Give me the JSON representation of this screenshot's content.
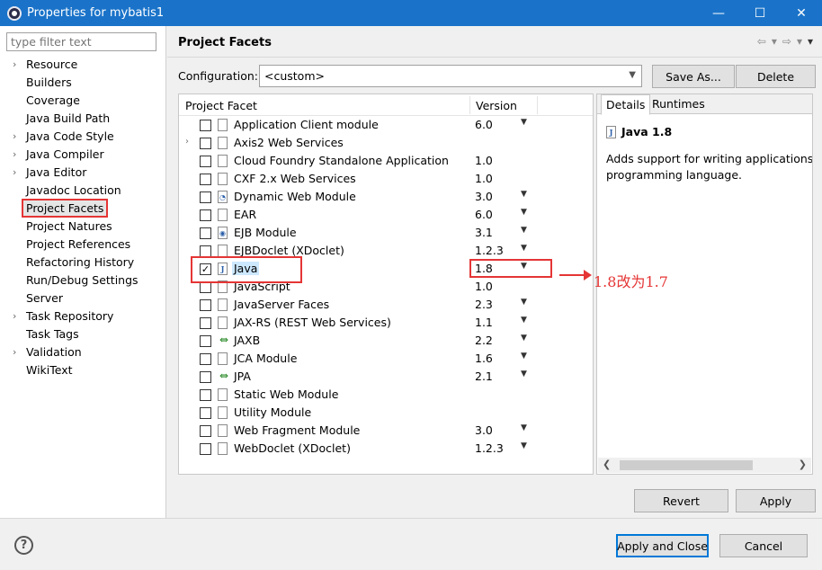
{
  "window": {
    "title": "Properties for mybatis1",
    "minimize": "—",
    "maximize": "☐",
    "close": "✕"
  },
  "filter": {
    "placeholder": "type filter text"
  },
  "nav": {
    "items": [
      {
        "label": "Resource",
        "expandable": true
      },
      {
        "label": "Builders",
        "expandable": false
      },
      {
        "label": "Coverage",
        "expandable": false
      },
      {
        "label": "Java Build Path",
        "expandable": false
      },
      {
        "label": "Java Code Style",
        "expandable": true
      },
      {
        "label": "Java Compiler",
        "expandable": true
      },
      {
        "label": "Java Editor",
        "expandable": true
      },
      {
        "label": "Javadoc Location",
        "expandable": false
      },
      {
        "label": "Project Facets",
        "expandable": false,
        "selected": true
      },
      {
        "label": "Project Natures",
        "expandable": false
      },
      {
        "label": "Project References",
        "expandable": false
      },
      {
        "label": "Refactoring History",
        "expandable": false
      },
      {
        "label": "Run/Debug Settings",
        "expandable": false
      },
      {
        "label": "Server",
        "expandable": false
      },
      {
        "label": "Task Repository",
        "expandable": true
      },
      {
        "label": "Task Tags",
        "expandable": false
      },
      {
        "label": "Validation",
        "expandable": true
      },
      {
        "label": "WikiText",
        "expandable": false
      }
    ]
  },
  "page": {
    "title": "Project Facets",
    "config_label": "Configuration:",
    "config_value": "<custom>",
    "save_as": "Save As...",
    "delete": "Delete"
  },
  "facets": {
    "col_facet": "Project Facet",
    "col_version": "Version",
    "rows": [
      {
        "name": "Application Client module",
        "version": "6.0",
        "dropdown": true,
        "checked": false,
        "icon": "file-icon"
      },
      {
        "name": "Axis2 Web Services",
        "version": "",
        "dropdown": false,
        "checked": false,
        "expandable": true,
        "icon": "file-icon"
      },
      {
        "name": "Cloud Foundry Standalone Application",
        "version": "1.0",
        "dropdown": false,
        "checked": false,
        "icon": "file-icon"
      },
      {
        "name": "CXF 2.x Web Services",
        "version": "1.0",
        "dropdown": false,
        "checked": false,
        "icon": "file-icon"
      },
      {
        "name": "Dynamic Web Module",
        "version": "3.0",
        "dropdown": true,
        "checked": false,
        "icon": "globe-icon"
      },
      {
        "name": "EAR",
        "version": "6.0",
        "dropdown": true,
        "checked": false,
        "icon": "file-icon"
      },
      {
        "name": "EJB Module",
        "version": "3.1",
        "dropdown": true,
        "checked": false,
        "icon": "bean-icon"
      },
      {
        "name": "EJBDoclet (XDoclet)",
        "version": "1.2.3",
        "dropdown": true,
        "checked": false,
        "icon": "file-icon"
      },
      {
        "name": "Java",
        "version": "1.8",
        "dropdown": true,
        "checked": true,
        "icon": "java-icon",
        "highlighted": true
      },
      {
        "name": "JavaScript",
        "version": "1.0",
        "dropdown": false,
        "checked": false,
        "icon": "file-icon"
      },
      {
        "name": "JavaServer Faces",
        "version": "2.3",
        "dropdown": true,
        "checked": false,
        "icon": "file-icon"
      },
      {
        "name": "JAX-RS (REST Web Services)",
        "version": "1.1",
        "dropdown": true,
        "checked": false,
        "icon": "file-icon"
      },
      {
        "name": "JAXB",
        "version": "2.2",
        "dropdown": true,
        "checked": false,
        "icon": "arrows-icon"
      },
      {
        "name": "JCA Module",
        "version": "1.6",
        "dropdown": true,
        "checked": false,
        "icon": "file-icon"
      },
      {
        "name": "JPA",
        "version": "2.1",
        "dropdown": true,
        "checked": false,
        "icon": "arrows-icon"
      },
      {
        "name": "Static Web Module",
        "version": "",
        "dropdown": false,
        "checked": false,
        "icon": "file-icon"
      },
      {
        "name": "Utility Module",
        "version": "",
        "dropdown": false,
        "checked": false,
        "icon": "file-icon"
      },
      {
        "name": "Web Fragment Module",
        "version": "3.0",
        "dropdown": true,
        "checked": false,
        "icon": "file-icon"
      },
      {
        "name": "WebDoclet (XDoclet)",
        "version": "1.2.3",
        "dropdown": true,
        "checked": false,
        "icon": "file-icon"
      }
    ]
  },
  "details": {
    "tab_details": "Details",
    "tab_runtimes": "Runtimes",
    "title": "Java 1.8",
    "line1": "Adds support for writing applications u",
    "line2": "programming language."
  },
  "buttons": {
    "revert": "Revert",
    "apply": "Apply",
    "apply_close": "Apply and Close",
    "cancel": "Cancel"
  },
  "annotation": {
    "text": "1.8改为1.7",
    "color": "#e53535"
  },
  "colors": {
    "titlebar": "#1a73c9",
    "accent": "#0078d7",
    "annotation": "#e53535",
    "selection": "#cce8ff"
  }
}
